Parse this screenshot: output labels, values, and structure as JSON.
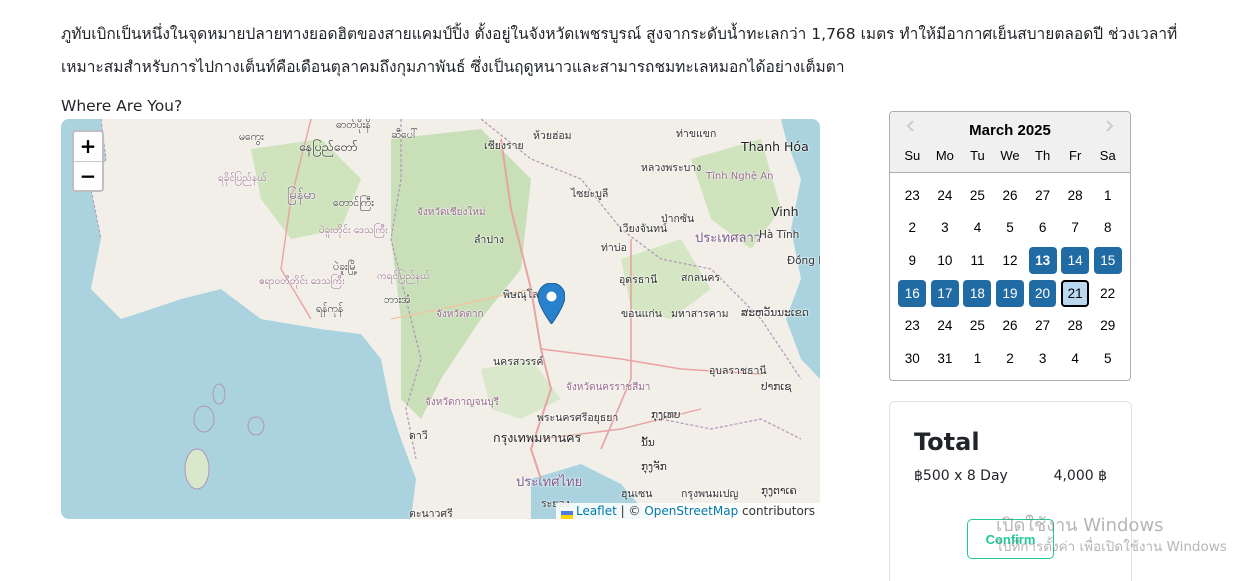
{
  "description": "ภูทับเบิกเป็นหนึ่งในจุดหมายปลายทางยอดฮิตของสายแคมป์ปิ้ง ตั้งอยู่ในจังหวัดเพชรบูรณ์ สูงจากระดับน้ำทะเลกว่า 1,768 เมตร ทำให้มีอากาศเย็นสบายตลอดปี ช่วงเวลาที่เหมาะสมสำหรับการไปกางเต็นท์คือเดือนตุลาคมถึงกุมภาพันธ์ ซึ่งเป็นฤดูหนาวและสามารถชมทะเลหมอกได้อย่างเต็มตา",
  "map": {
    "title": "Where Are You?",
    "zoom_in": "+",
    "zoom_out": "−",
    "attribution": {
      "leaflet": "Leaflet",
      "sep": "| ©",
      "osm": "OpenStreetMap",
      "suffix": "contributors"
    },
    "labels": {
      "l1": "ဓာတ်ပိုးနိ",
      "l2": "မကွေး",
      "l3": "နေပြည်တော်",
      "l4": "ဆီပေါ်",
      "l5": "ရခိုင်ပြည်နယ်",
      "l6": "မြန်မာ",
      "l7": "တောင်ကြီး",
      "l8": "ပဲခူးတိုင်း ဒေသကြီး",
      "l9": "ပဲခူးမြို့",
      "l10": "ဧရာဝတီတိုင်း ဒေသကြီး",
      "l11": "ကရင်ပြည်နယ်",
      "l12": "ရန်ကုန်",
      "l13": "ဘားအံ",
      "l14": "เชียงราย",
      "l15": "ห้วยฮ่อม",
      "l16": "จังหวัดเชียงใหม่",
      "l17": "ลำปาง",
      "l18": "ไซยะบูลี",
      "l19": "เวียงจันทน์",
      "l20": "ป่ากซัน",
      "l21": "หลวงพระบาง",
      "l22": "ท่าขแขก",
      "l23": "Thanh Hóa",
      "l24": "Vinh",
      "l25": "Tĩnh Nghệ An",
      "l26": "ประเทศลาว",
      "l27": "Hà Tĩnh",
      "l28": "อุดรธานี",
      "l29": "สกลนคร",
      "l30": "Đồng H",
      "l31": "พิษณุโลก",
      "l32": "ขอนแก่น",
      "l33": "มหาสารคาม",
      "l34": "นครสวรรค์",
      "l35": "จังหวัดนครราชสีมา",
      "l36": "อุบลราชธานี",
      "l37": "จังหวัดกาญจนบุรี",
      "l38": "พระนครศรีอยุธยา",
      "l39": "กรุงเทพมหานคร",
      "l40": "ประเทศไทย",
      "l41": "ระยอง",
      "l42": "ดาวี",
      "l43": "ตะนาวศรี",
      "l44": "จังหวัดตาก",
      "l45": "ท่าบ่อ",
      "l46": "ກຸງເທບ",
      "l47": "ກຸງຈັກ",
      "l48": "ນັ້ນ",
      "l49": "ປາກເຊ",
      "l50": "ສະຫວັນນະເຂດ",
      "l51": "ฮุนเซน",
      "l52": "กรุงพนมเปญ",
      "l53": "ກຸງຕາເຄ"
    }
  },
  "calendar": {
    "month_label": "March 2025",
    "weekdays": [
      "Su",
      "Mo",
      "Tu",
      "We",
      "Th",
      "Fr",
      "Sa"
    ],
    "weeks": [
      [
        "23",
        "24",
        "25",
        "26",
        "27",
        "28",
        "1"
      ],
      [
        "2",
        "3",
        "4",
        "5",
        "6",
        "7",
        "8"
      ],
      [
        "9",
        "10",
        "11",
        "12",
        "13",
        "14",
        "15"
      ],
      [
        "16",
        "17",
        "18",
        "19",
        "20",
        "21",
        "22"
      ],
      [
        "23",
        "24",
        "25",
        "26",
        "27",
        "28",
        "29"
      ],
      [
        "30",
        "31",
        "1",
        "2",
        "3",
        "4",
        "5"
      ]
    ],
    "range_start": "13",
    "range_end": "21",
    "prev_label": "‹",
    "next_label": "›"
  },
  "summary": {
    "title": "Total",
    "line_label": "฿500 x 8 Day",
    "line_amount": "4,000 ฿",
    "confirm_label": "Confirm"
  },
  "watermark": {
    "line1": "เปิดใช้งาน Windows",
    "line2": "ไปที่การตั้งค่า เพื่อเปิดใช้งาน Windows"
  },
  "colors": {
    "selected": "#216ba5",
    "today_bg": "#bad9f1",
    "confirm": "#20c997",
    "water": "#aad3df",
    "land": "#f2efe9",
    "forest": "#add19e",
    "marker": "#2a81cb"
  }
}
